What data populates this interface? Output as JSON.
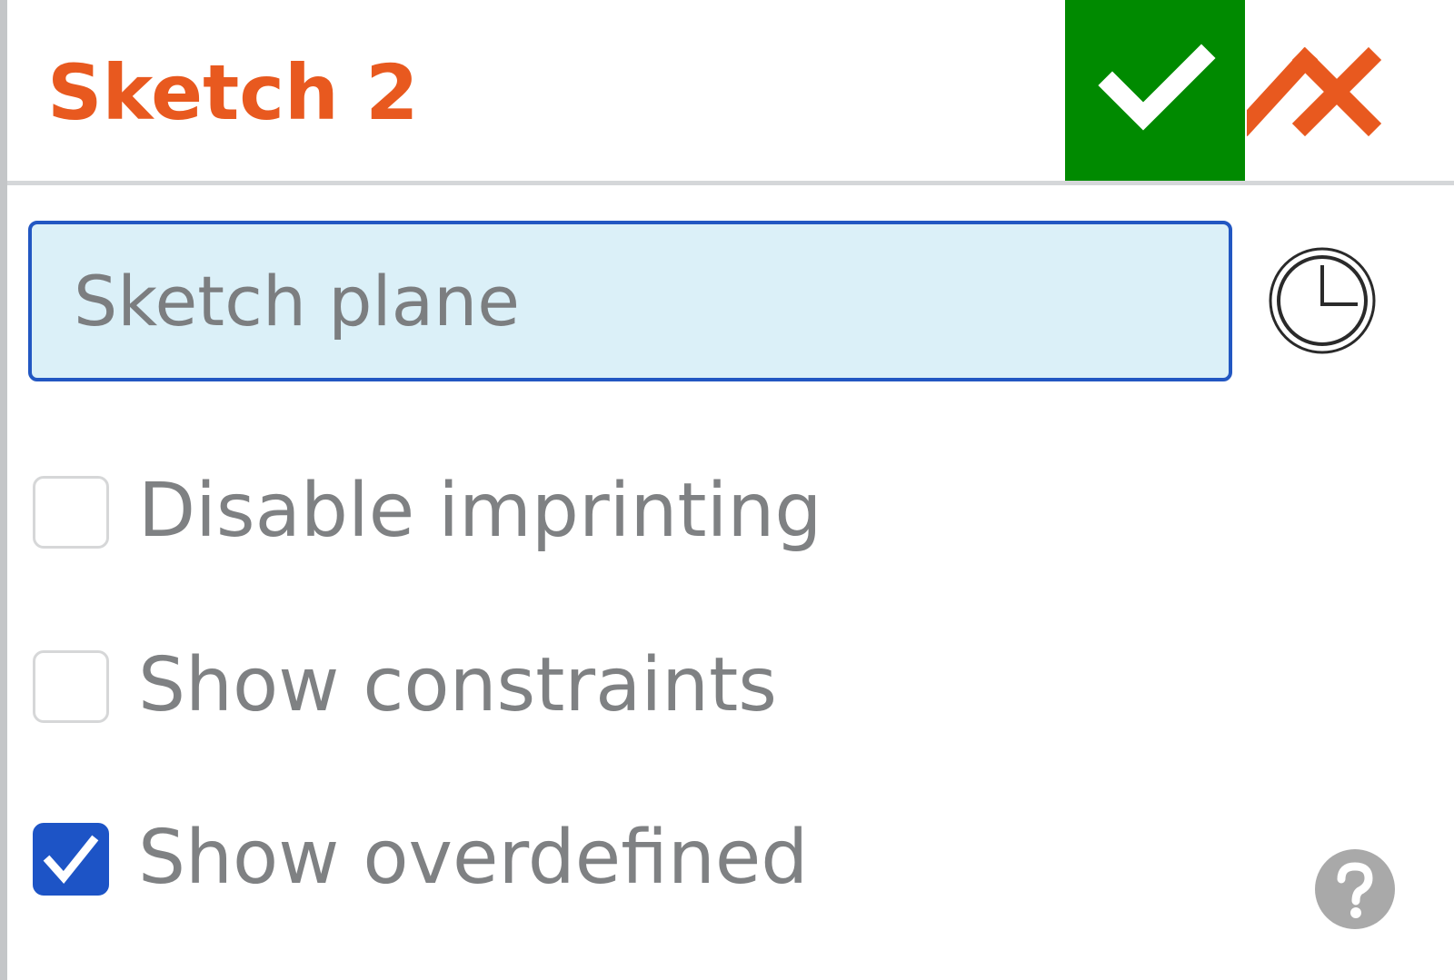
{
  "header": {
    "title": "Sketch 2",
    "accept_icon": "checkmark-icon",
    "cancel_icon": "close-icon",
    "colors": {
      "title": "#e8591f",
      "accept_bg": "#008a00",
      "cancel": "#e8591f"
    }
  },
  "sketch_plane": {
    "placeholder": "Sketch plane",
    "value": "",
    "history_icon": "clock-icon"
  },
  "options": [
    {
      "label": "Disable imprinting",
      "checked": false
    },
    {
      "label": "Show constraints",
      "checked": false
    },
    {
      "label": "Show overdefined",
      "checked": true
    }
  ],
  "help": {
    "icon": "help-icon"
  },
  "colors": {
    "input_bg": "#dbf0f8",
    "input_border": "#2257c2",
    "checkbox_checked": "#1d54c6",
    "label_text": "#7f8183"
  }
}
